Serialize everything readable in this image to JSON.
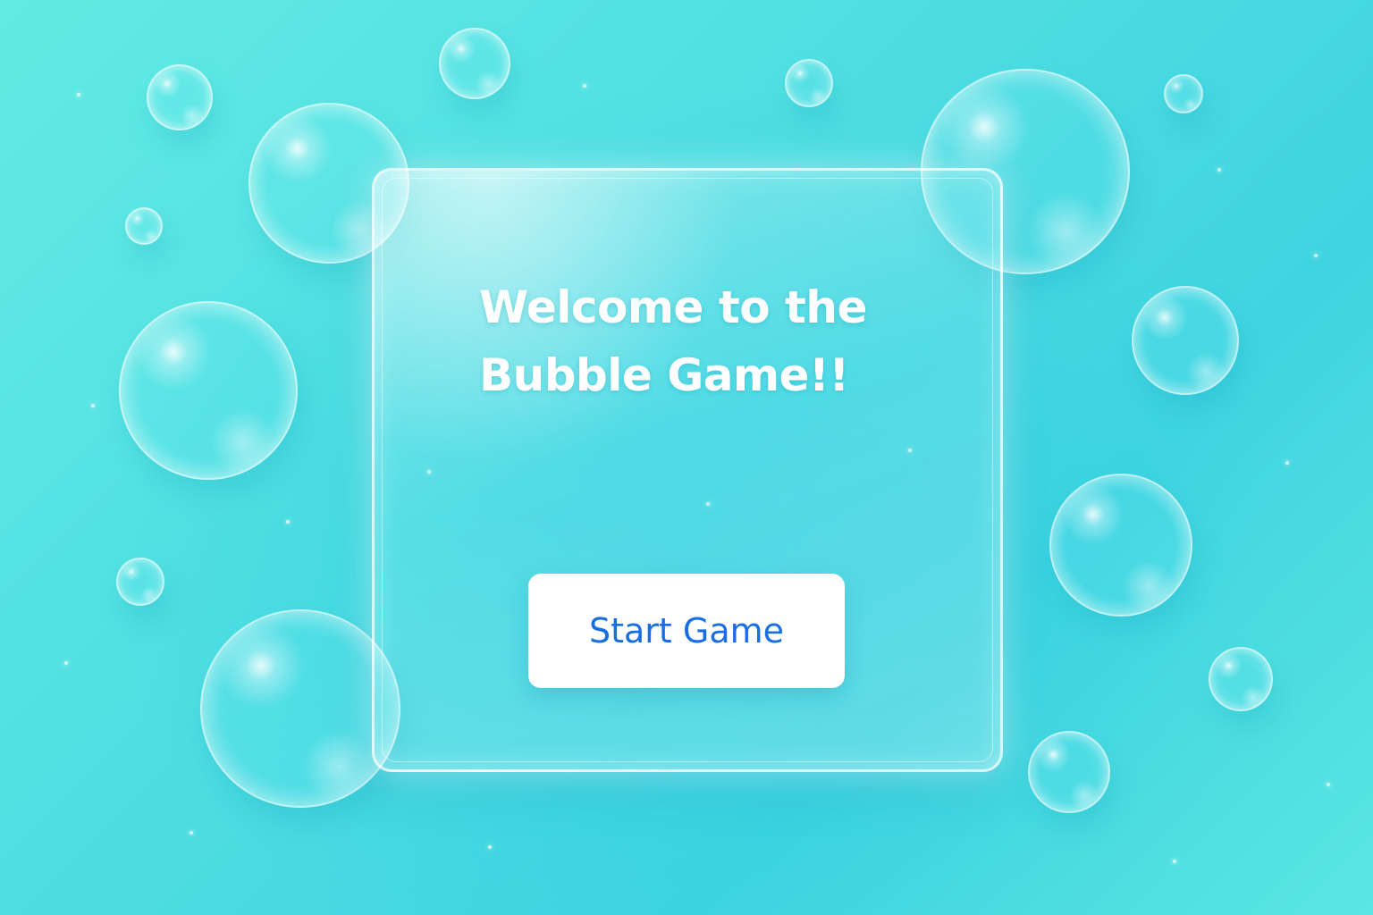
{
  "colors": {
    "background": "#4fdee2",
    "title_text": "#ffffff",
    "button_background": "#ffffff",
    "button_text": "#1a6fe0"
  },
  "welcome_screen": {
    "title_line_1": "Welcome to the",
    "title_line_2": "Bubble Game!!",
    "start_button_label": "Start Game"
  }
}
